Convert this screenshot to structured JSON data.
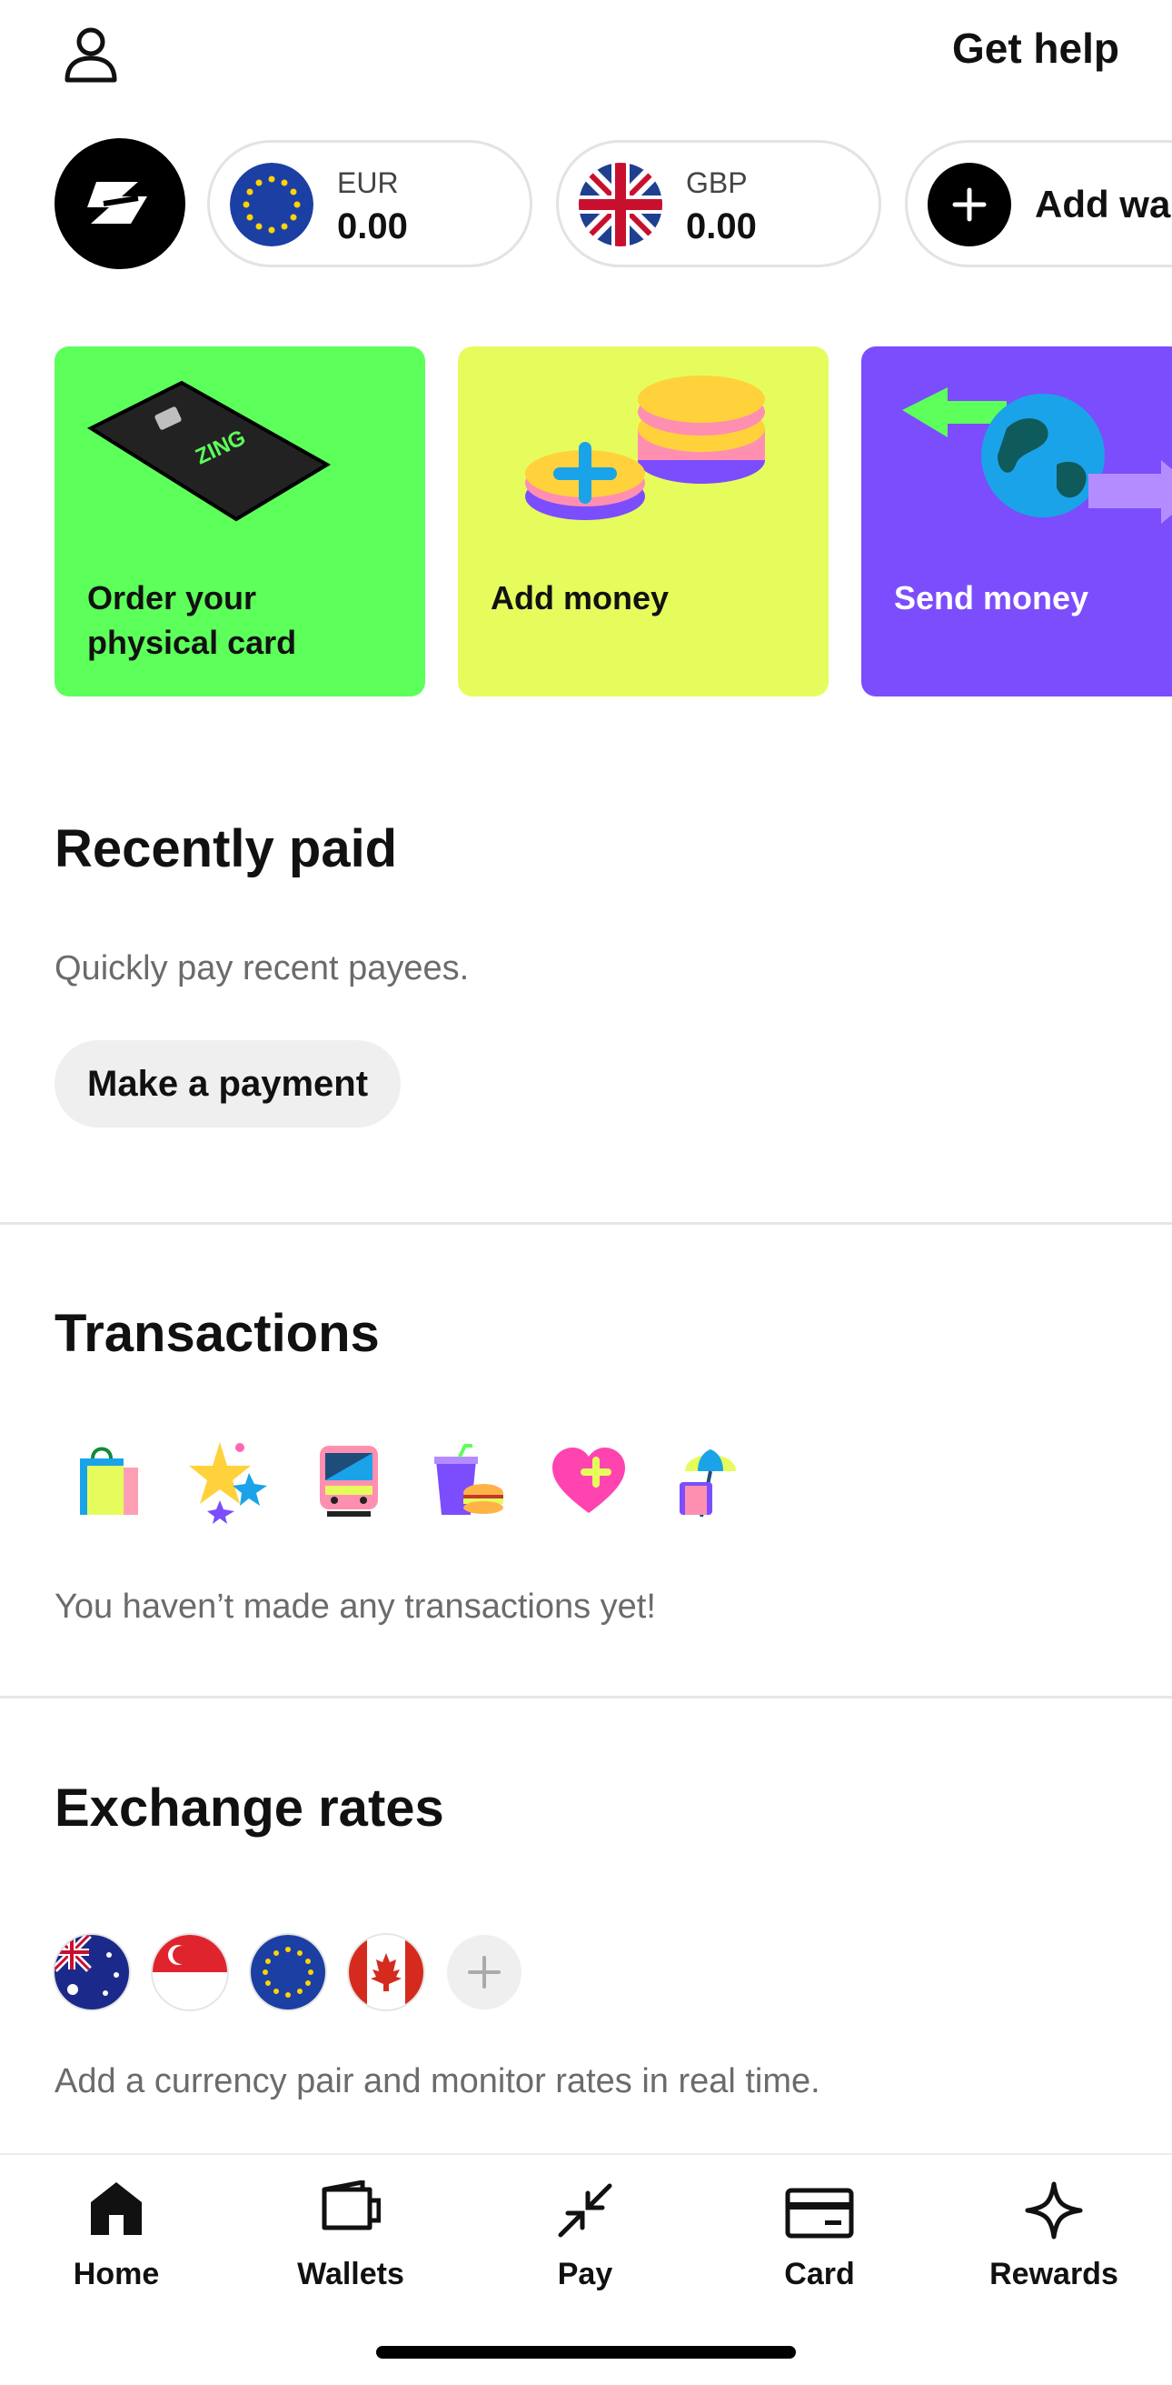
{
  "header": {
    "profile_icon": "person-icon",
    "help_label": "Get help"
  },
  "wallets": [
    {
      "code": "EUR",
      "amount": "0.00",
      "flag": "eu-flag-icon"
    },
    {
      "code": "GBP",
      "amount": "0.00",
      "flag": "uk-flag-icon"
    }
  ],
  "add_wallet_label": "Add wallet",
  "promo_cards": [
    {
      "title": "Order your physical card",
      "color": "#5dff5a",
      "card_text": "ZING"
    },
    {
      "title": "Add money",
      "color": "#e6fc5d"
    },
    {
      "title": "Send money",
      "color": "#7b4dfc"
    }
  ],
  "recently_paid": {
    "title": "Recently paid",
    "description": "Quickly pay recent payees.",
    "button_label": "Make a payment"
  },
  "transactions": {
    "title": "Transactions",
    "icons": [
      "shopping-bags-icon",
      "stars-icon",
      "train-icon",
      "food-drink-icon",
      "heart-plus-icon",
      "beach-luggage-icon"
    ],
    "empty_text": "You haven’t made any transactions yet!"
  },
  "exchange_rates": {
    "title": "Exchange rates",
    "flags": [
      "australia-flag-icon",
      "singapore-flag-icon",
      "eu-flag-icon",
      "canada-flag-icon"
    ],
    "description": "Add a currency pair and monitor rates in real time."
  },
  "nav": [
    {
      "label": "Home",
      "icon": "home-icon",
      "active": true
    },
    {
      "label": "Wallets",
      "icon": "wallet-icon"
    },
    {
      "label": "Pay",
      "icon": "pay-arrows-icon"
    },
    {
      "label": "Card",
      "icon": "card-icon"
    },
    {
      "label": "Rewards",
      "icon": "sparkle-icon"
    }
  ],
  "colors": {
    "green_card": "#5dff5a",
    "yellow_card": "#e6fc5d",
    "purple_card": "#7b4dfc",
    "text": "#111111",
    "muted": "#6b6b6b"
  }
}
